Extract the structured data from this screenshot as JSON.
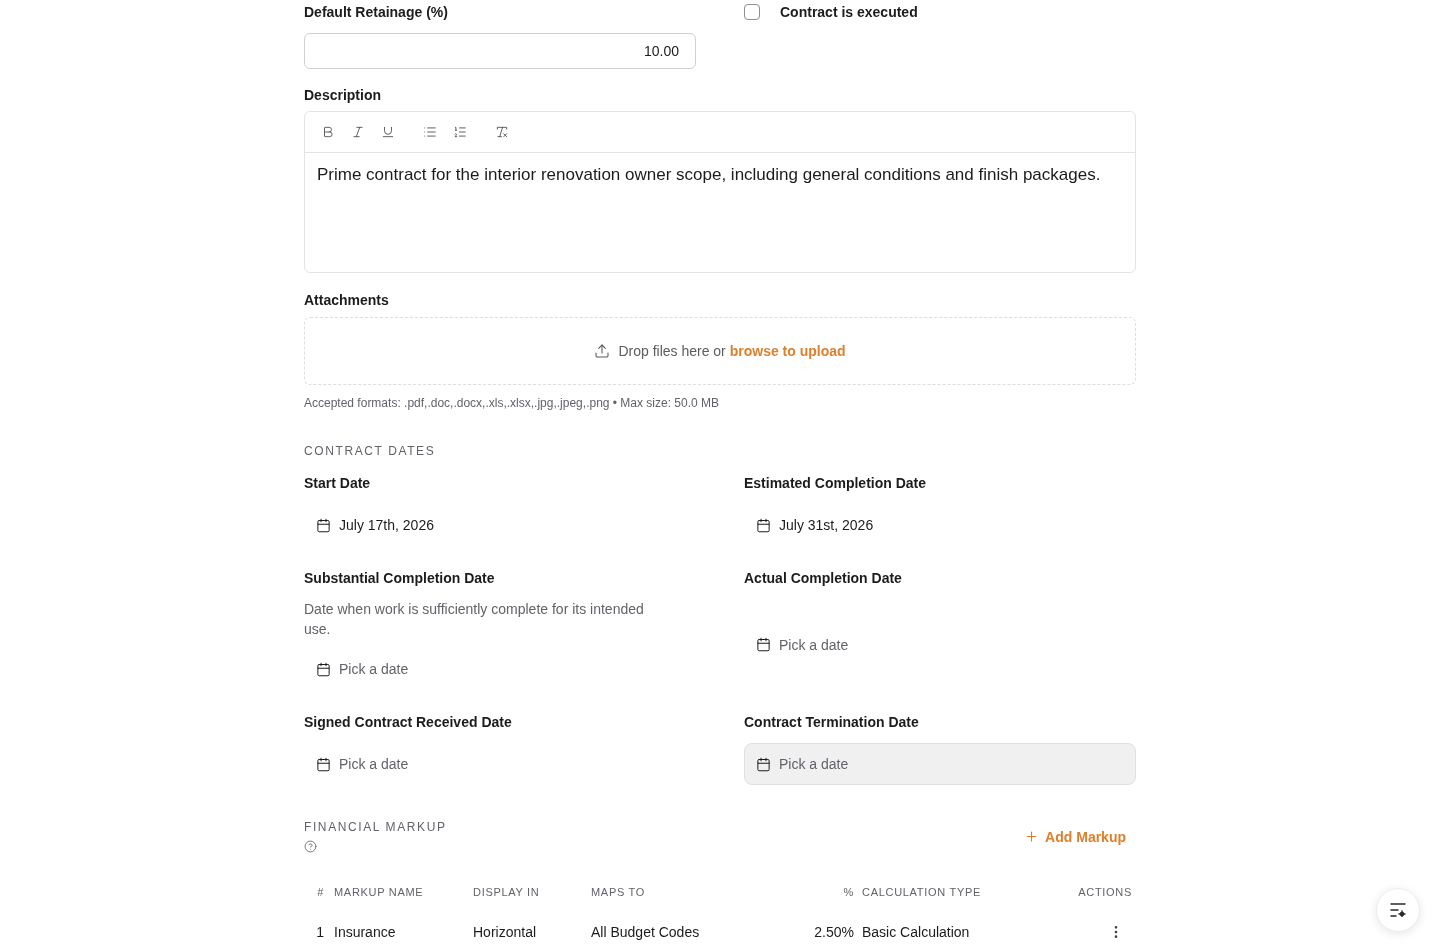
{
  "retainage": {
    "label": "Default Retainage (%)",
    "value": "10.00"
  },
  "executed": {
    "label": "Contract is executed",
    "checked": false
  },
  "description": {
    "label": "Description",
    "value": "Prime contract for the interior renovation owner scope, including general conditions and finish packages."
  },
  "attachments": {
    "label": "Attachments",
    "drop_text": "Drop files here or",
    "browse_link": "browse to upload",
    "hint": "Accepted formats: .pdf,.doc,.docx,.xls,.xlsx,.jpg,.jpeg,.png • Max size: 50.0 MB"
  },
  "contract_dates": {
    "heading": "CONTRACT DATES",
    "fields": [
      {
        "label": "Start Date",
        "value": "July 17th, 2026",
        "hovered": false
      },
      {
        "label": "Estimated Completion Date",
        "value": "July 31st, 2026",
        "hovered": false
      },
      {
        "label": "Substantial Completion Date",
        "help": "Date when work is sufficiently complete for its intended use.",
        "placeholder": "Pick a date",
        "hovered": false
      },
      {
        "label": "Actual Completion Date",
        "placeholder": "Pick a date",
        "hovered": false
      },
      {
        "label": "Signed Contract Received Date",
        "placeholder": "Pick a date",
        "hovered": false
      },
      {
        "label": "Contract Termination Date",
        "placeholder": "Pick a date",
        "hovered": true
      }
    ]
  },
  "financial_markup": {
    "heading": "FINANCIAL MARKUP",
    "add_button": "Add Markup",
    "columns": [
      "#",
      "MARKUP NAME",
      "DISPLAY IN",
      "MAPS TO",
      "%",
      "CALCULATION TYPE",
      "ACTIONS"
    ],
    "rows": [
      {
        "number": "1",
        "name": "Insurance",
        "display_in": "Horizontal",
        "maps_to": "All Budget Codes",
        "percent": "2.50%",
        "calculation_type": "Basic Calculation"
      }
    ]
  }
}
